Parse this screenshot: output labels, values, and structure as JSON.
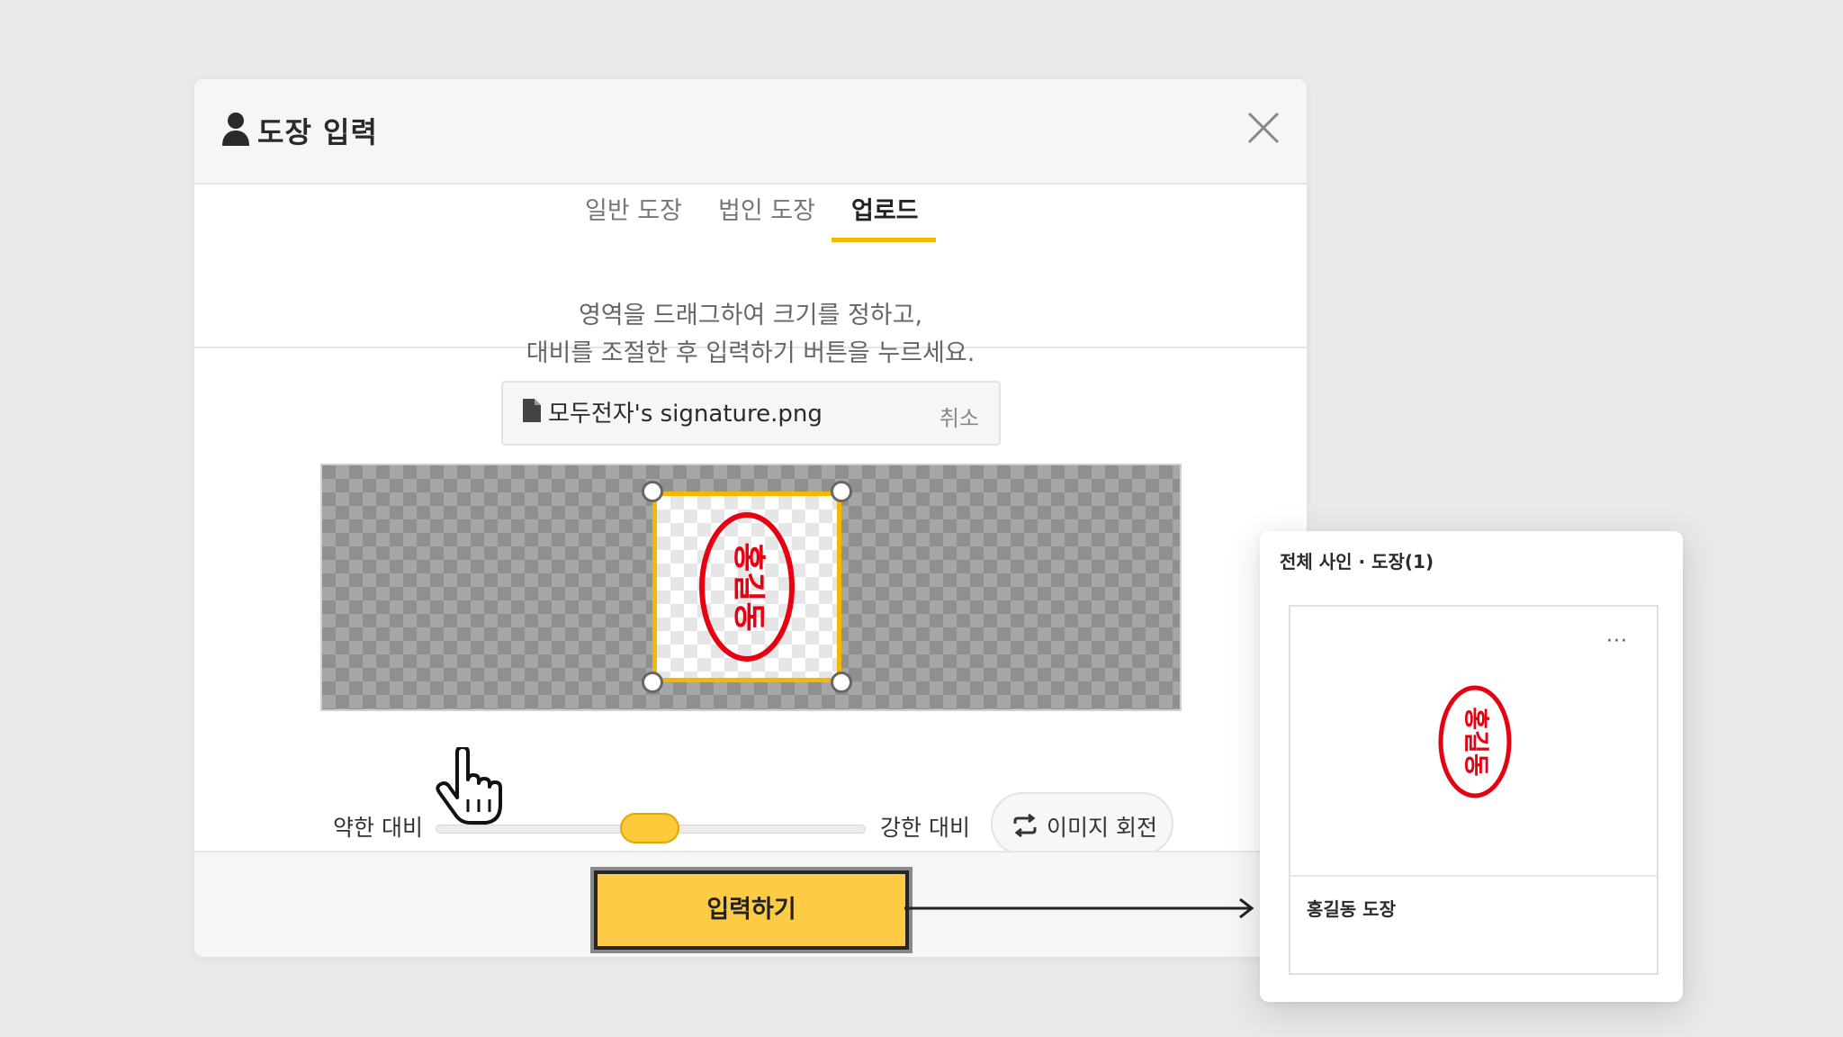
{
  "modal": {
    "title": "도장 입력",
    "tabs": [
      {
        "label": "일반 도장",
        "active": false
      },
      {
        "label": "법인 도장",
        "active": false
      },
      {
        "label": "업로드",
        "active": true
      }
    ],
    "instructions": {
      "line1": "영역을 드래그하여 크기를 정하고,",
      "line2": "대비를 조절한 후 입력하기 버튼을 누르세요."
    },
    "file": {
      "name": "모두전자's signature.png",
      "cancel_label": "취소"
    },
    "stamp_text": "홍길동",
    "contrast": {
      "weak_label": "약한 대비",
      "strong_label": "강한 대비",
      "value_fraction": 0.42
    },
    "rotate_label": "이미지 회전",
    "submit_label": "입력하기"
  },
  "side_panel": {
    "title": "전체 사인 · 도장(1)",
    "card": {
      "more_label": "···",
      "stamp_text": "홍길동",
      "label": "홍길동 도장"
    }
  },
  "colors": {
    "accent": "#f5b800",
    "button": "#fdcb45",
    "stamp_red": "#e60012"
  },
  "icons": [
    "user-icon",
    "close-icon",
    "file-icon",
    "rotate-icon",
    "hand-cursor-icon",
    "arrow-right-icon",
    "more-icon"
  ]
}
